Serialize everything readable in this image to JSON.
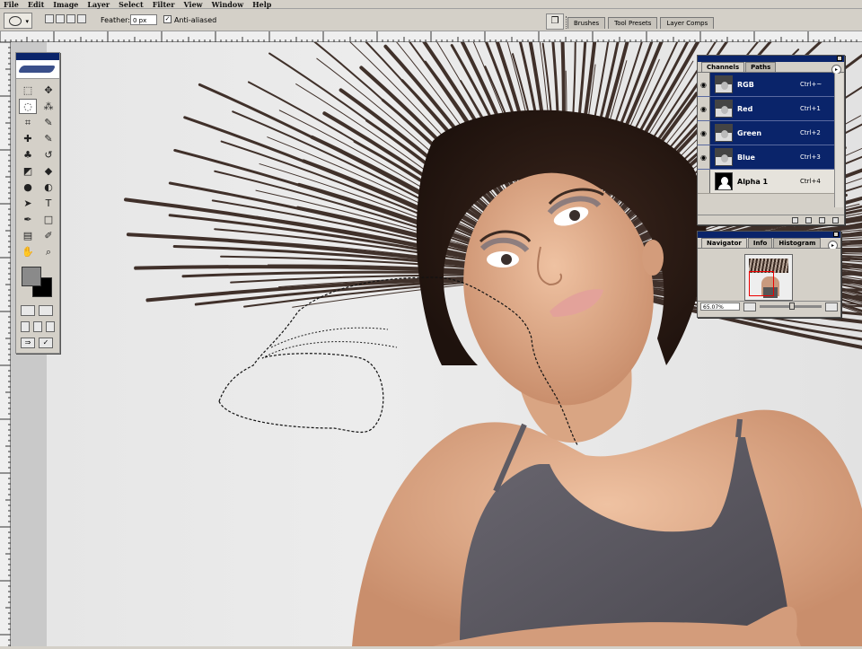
{
  "menu": [
    "File",
    "Edit",
    "Image",
    "Layer",
    "Select",
    "Filter",
    "View",
    "Window",
    "Help"
  ],
  "options_bar": {
    "feather_label": "Feather:",
    "feather_value": "0 px",
    "antialiased_label": "Anti-aliased",
    "antialiased_checked": true,
    "palette_well_tabs": [
      "Brushes",
      "Tool Presets",
      "Layer Comps"
    ]
  },
  "toolbox": {
    "tools": [
      {
        "name": "marquee",
        "glyph": "⬚"
      },
      {
        "name": "move",
        "glyph": "✥"
      },
      {
        "name": "lasso",
        "glyph": "◌"
      },
      {
        "name": "magic-wand",
        "glyph": "⁂"
      },
      {
        "name": "crop",
        "glyph": "⌗"
      },
      {
        "name": "slice",
        "glyph": "✎"
      },
      {
        "name": "healing",
        "glyph": "✚"
      },
      {
        "name": "brush",
        "glyph": "✎"
      },
      {
        "name": "stamp",
        "glyph": "♣"
      },
      {
        "name": "history-brush",
        "glyph": "↺"
      },
      {
        "name": "eraser",
        "glyph": "◩"
      },
      {
        "name": "fill",
        "glyph": "◆"
      },
      {
        "name": "blur",
        "glyph": "●"
      },
      {
        "name": "dodge",
        "glyph": "◐"
      },
      {
        "name": "path-select",
        "glyph": "➤"
      },
      {
        "name": "type",
        "glyph": "T"
      },
      {
        "name": "pen",
        "glyph": "✒"
      },
      {
        "name": "shape",
        "glyph": "□"
      },
      {
        "name": "notes",
        "glyph": "▤"
      },
      {
        "name": "eyedropper",
        "glyph": "✐"
      },
      {
        "name": "hand",
        "glyph": "✋"
      },
      {
        "name": "zoom",
        "glyph": "⌕"
      }
    ],
    "active_tool": "lasso",
    "foreground_color": "#8a8a8a",
    "background_color": "#000000"
  },
  "channels_panel": {
    "tabs": [
      "Channels",
      "Paths"
    ],
    "active_tab": "Channels",
    "channels": [
      {
        "name": "RGB",
        "shortcut": "Ctrl+~",
        "selected": true,
        "visible": true
      },
      {
        "name": "Red",
        "shortcut": "Ctrl+1",
        "selected": true,
        "visible": true
      },
      {
        "name": "Green",
        "shortcut": "Ctrl+2",
        "selected": true,
        "visible": true
      },
      {
        "name": "Blue",
        "shortcut": "Ctrl+3",
        "selected": true,
        "visible": true
      },
      {
        "name": "Alpha 1",
        "shortcut": "Ctrl+4",
        "selected": false,
        "visible": false
      }
    ]
  },
  "navigator_panel": {
    "tabs": [
      "Navigator",
      "Info",
      "Histogram"
    ],
    "active_tab": "Navigator",
    "zoom": "65.07%"
  },
  "colors": {
    "title_blue": "#0a246a",
    "ui_gray": "#d4d0c8",
    "hair": "#2e1d16",
    "skin": "#d9a583",
    "top_fabric": "#5e5b63"
  }
}
